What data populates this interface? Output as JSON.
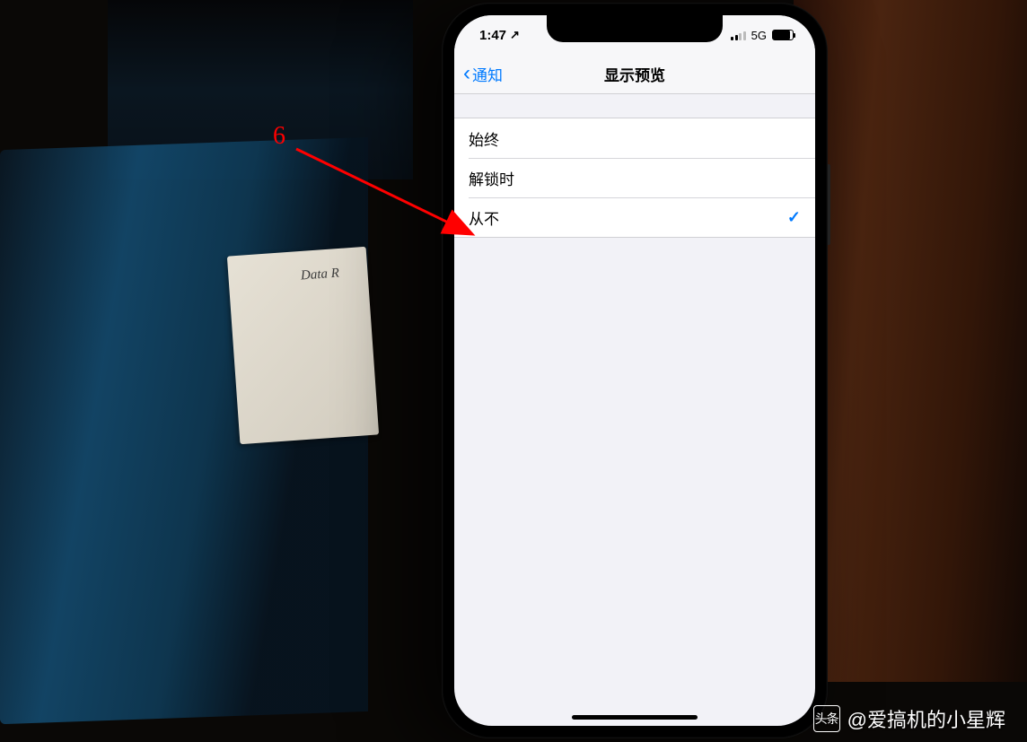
{
  "annotation": {
    "step_number": "6"
  },
  "background": {
    "card_text": "Data R"
  },
  "status_bar": {
    "time": "1:47",
    "location_icon": "↗",
    "network_label": "5G"
  },
  "nav": {
    "back_label": "通知",
    "title": "显示预览"
  },
  "options": [
    {
      "label": "始终",
      "selected": false
    },
    {
      "label": "解锁时",
      "selected": false
    },
    {
      "label": "从不",
      "selected": true
    }
  ],
  "watermark": {
    "badge": "头条",
    "text": "@爱搞机的小星辉"
  }
}
